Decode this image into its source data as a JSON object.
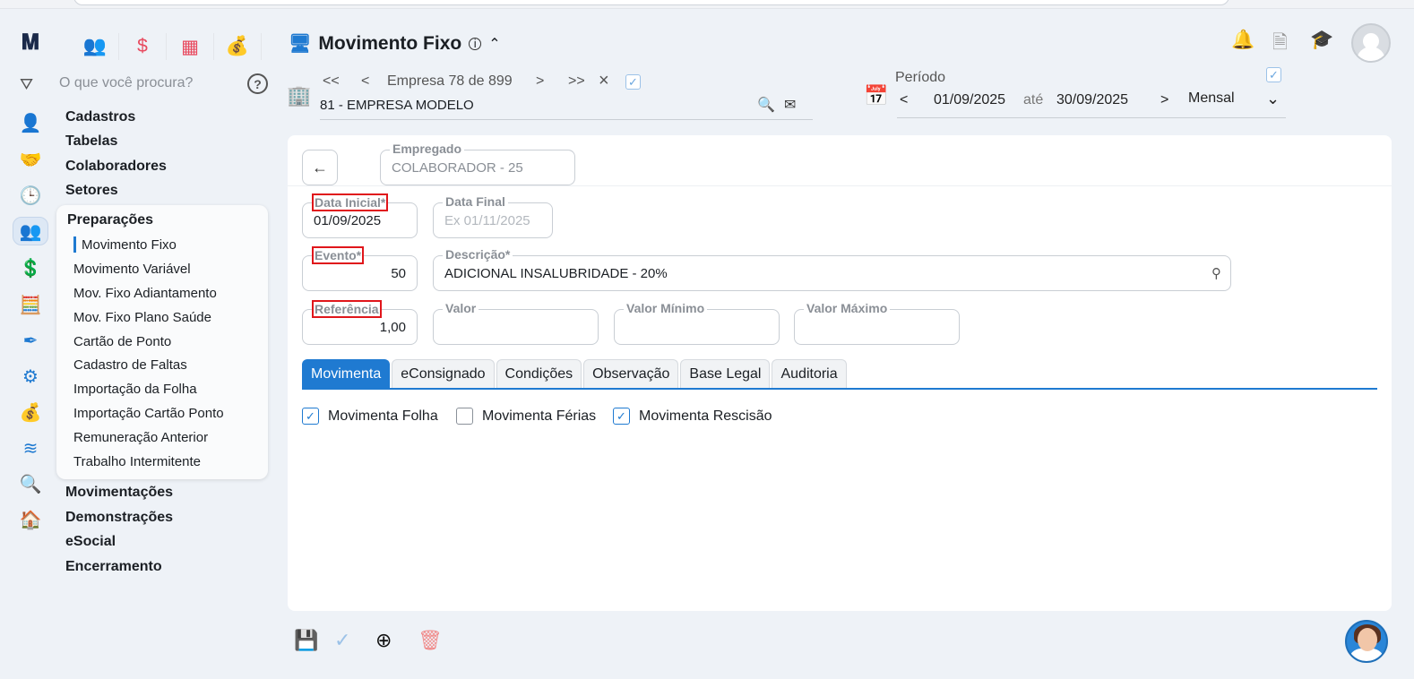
{
  "header": {
    "title": "Movimento Fixo",
    "search_placeholder": "O que você procura?"
  },
  "company_nav": {
    "first": "<<",
    "prev": "<",
    "label": "Empresa 78 de 899",
    "next": ">",
    "last": ">>",
    "clear": "×",
    "company": "81 - EMPRESA MODELO"
  },
  "period": {
    "label": "Período",
    "prev": "<",
    "start": "01/09/2025",
    "until": "até",
    "end": "30/09/2025",
    "next": ">",
    "type": "Mensal"
  },
  "menu": {
    "top_items": [
      "Cadastros",
      "Tabelas",
      "Colaboradores",
      "Setores"
    ],
    "submenu_title": "Preparações",
    "submenu_items": [
      "Movimento Fixo",
      "Movimento Variável",
      "Mov. Fixo Adiantamento",
      "Mov. Fixo Plano Saúde",
      "Cartão de Ponto",
      "Cadastro de Faltas",
      "Importação da Folha",
      "Importação Cartão Ponto",
      "Remuneração Anterior",
      "Trabalho Intermitente"
    ],
    "bottom_items": [
      "Movimentações",
      "Demonstrações",
      "eSocial",
      "Encerramento"
    ]
  },
  "form": {
    "empregado": {
      "label": "Empregado",
      "value": "COLABORADOR - 25"
    },
    "data_inicial": {
      "label": "Data Inicial*",
      "value": "01/09/2025"
    },
    "data_final": {
      "label": "Data Final",
      "placeholder": "Ex 01/11/2025"
    },
    "evento": {
      "label": "Evento*",
      "value": "50"
    },
    "descricao": {
      "label": "Descrição*",
      "value": "ADICIONAL INSALUBRIDADE - 20%"
    },
    "referencia": {
      "label": "Referência",
      "value": "1,00"
    },
    "valor": {
      "label": "Valor",
      "value": ""
    },
    "valor_minimo": {
      "label": "Valor Mínimo",
      "value": ""
    },
    "valor_maximo": {
      "label": "Valor Máximo",
      "value": ""
    }
  },
  "tabs": [
    "Movimenta",
    "eConsignado",
    "Condições",
    "Observação",
    "Base Legal",
    "Auditoria"
  ],
  "checkboxes": [
    {
      "label": "Movimenta Folha",
      "checked": true
    },
    {
      "label": "Movimenta Férias",
      "checked": false
    },
    {
      "label": "Movimenta Rescisão",
      "checked": true
    }
  ],
  "colors": {
    "accent": "#1f7ad1",
    "required_highlight": "#e0161b",
    "save": "#1aa57a",
    "delete": "#f08a8a"
  }
}
